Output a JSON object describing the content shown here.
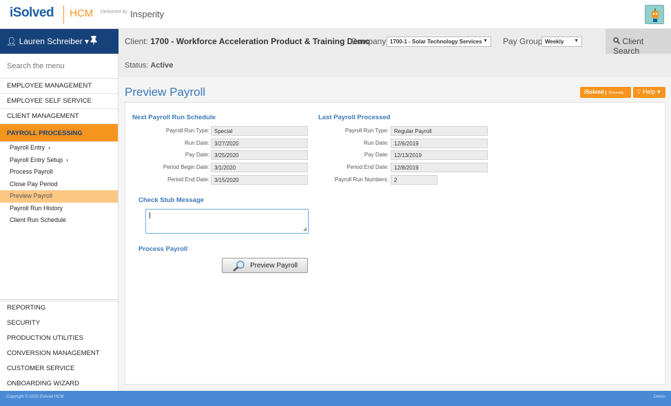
{
  "header": {
    "logo_isolved": "iSolved",
    "logo_hcm": "HCM",
    "delivered_by": "Delivered by",
    "insperity": "Insperity"
  },
  "user": {
    "name": "Lauren Schreiber",
    "caret": "▾",
    "pin": "📌"
  },
  "client_bar": {
    "client_label": "Client:",
    "client_value": "1700 - Workforce Acceleration Product & Training Demo",
    "company_label": "Company:",
    "company_value": "1700-1 - Solar Technology Services",
    "pay_group_label": "Pay Group:",
    "pay_group_value": "Weekly",
    "client_search": "Client Search",
    "status_label": "Status:",
    "status_value": "Active"
  },
  "sidebar": {
    "search_placeholder": "Search the menu",
    "top_items": [
      "EMPLOYEE MANAGEMENT",
      "EMPLOYEE SELF SERVICE",
      "CLIENT MANAGEMENT",
      "PAYROLL PROCESSING"
    ],
    "sub_items": [
      "Payroll Entry",
      "Payroll Entry Setup",
      "Process Payroll",
      "Close Pay Period",
      "Preview Payroll",
      "Payroll Run History",
      "Client Run Schedule"
    ],
    "bottom_items": [
      "REPORTING",
      "SECURITY",
      "PRODUCTION UTILITIES",
      "CONVERSION MANAGEMENT",
      "CUSTOMER SERVICE",
      "ONBOARDING WIZARD"
    ]
  },
  "page": {
    "title": "Preview Payroll",
    "univ_button": "iSolved",
    "univ_small": "University",
    "help_button": "Help"
  },
  "next_run": {
    "title": "Next Payroll Run Schedule",
    "fields": [
      {
        "label": "Payroll Run Type:",
        "value": "Special"
      },
      {
        "label": "Run Date:",
        "value": "3/27/2020"
      },
      {
        "label": "Pay Date:",
        "value": "3/25/2020"
      },
      {
        "label": "Period Begin Date:",
        "value": "3/1/2020"
      },
      {
        "label": "Period End Date:",
        "value": "3/15/2020"
      }
    ]
  },
  "last_run": {
    "title": "Last Payroll Processed",
    "fields": [
      {
        "label": "Payroll Run Type:",
        "value": "Regular Payroll"
      },
      {
        "label": "Run Date:",
        "value": "12/6/2019"
      },
      {
        "label": "Pay Date:",
        "value": "12/13/2019"
      },
      {
        "label": "Period End Date:",
        "value": "12/8/2019"
      },
      {
        "label": "Payroll Run Numbers:",
        "value": "2"
      }
    ]
  },
  "check_stub": {
    "title": "Check Stub Message",
    "value": ""
  },
  "process": {
    "title": "Process Payroll",
    "button": "Preview Payroll"
  },
  "footer": {
    "copyright": "Copyright © 2020 iSolved HCM",
    "demo": "Demo"
  },
  "colors": {
    "accent": "#f7941d",
    "nav_blue": "#16427a",
    "link_blue": "#3a78b8",
    "footer": "#4a8ad4"
  },
  "icons": {
    "user": "user-icon",
    "pin": "pin-icon",
    "search": "search-icon",
    "help": "lightbulb-icon",
    "preview": "magnifier-icon",
    "chevron": "chevron-right-icon"
  }
}
